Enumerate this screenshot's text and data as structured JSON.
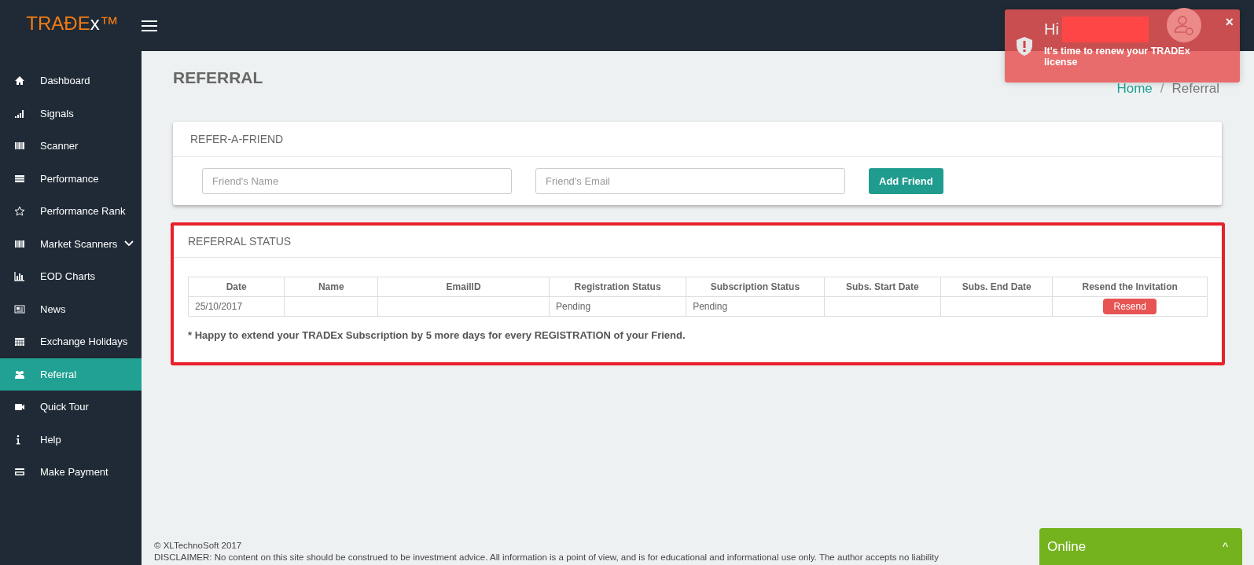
{
  "header": {
    "logo_main": "TRAĐE",
    "logo_x": "x",
    "logo_tm": "™"
  },
  "sidebar": {
    "items": [
      {
        "label": "Dashboard",
        "selected": false,
        "submenu": false
      },
      {
        "label": "Signals",
        "selected": false,
        "submenu": false
      },
      {
        "label": "Scanner",
        "selected": false,
        "submenu": false
      },
      {
        "label": "Performance",
        "selected": false,
        "submenu": false
      },
      {
        "label": "Performance Rank",
        "selected": false,
        "submenu": false
      },
      {
        "label": "Market Scanners",
        "selected": false,
        "submenu": true
      },
      {
        "label": "EOD Charts",
        "selected": false,
        "submenu": false
      },
      {
        "label": "News",
        "selected": false,
        "submenu": false
      },
      {
        "label": "Exchange Holidays",
        "selected": false,
        "submenu": false
      },
      {
        "label": "Referral",
        "selected": true,
        "submenu": false
      },
      {
        "label": "Quick Tour",
        "selected": false,
        "submenu": false
      },
      {
        "label": "Help",
        "selected": false,
        "submenu": false
      },
      {
        "label": "Make Payment",
        "selected": false,
        "submenu": false
      }
    ]
  },
  "page_title": "REFERRAL",
  "breadcrumb": [
    {
      "label": "Home",
      "kind": "link"
    },
    {
      "label": "/",
      "kind": "separator"
    },
    {
      "label": "Referral",
      "kind": "current"
    }
  ],
  "refer_card": {
    "title": "REFER-A-FRIEND",
    "name_field": {
      "placeholder": "Friend's Name"
    },
    "email_field": {
      "placeholder": "Friend's Email"
    },
    "button": "Add Friend"
  },
  "status_card": {
    "title": "REFERRAL STATUS",
    "highlighted": true,
    "table": {
      "columns": [
        "Date",
        "Name",
        "EmailID",
        "Registration Status",
        "Subscription Status",
        "Subs. Start Date",
        "Subs. End Date",
        "Resend the Invitation"
      ],
      "rows": [
        {
          "cells": [
            "25/10/2017",
            "",
            "",
            "Pending",
            "Pending",
            "",
            ""
          ],
          "action": "Resend"
        }
      ]
    },
    "note": "* Happy to extend your TRADEx Subscription by 5 more days for every REGISTRATION of your Friend."
  },
  "notification": {
    "greeting": "Hi",
    "message": "It's time to renew your TRADEx license",
    "close": "×"
  },
  "footer": {
    "copyright": "© XLTechnoSoft 2017",
    "disclaimer": "DISCLAIMER: No content on this site should be construed to be investment advice. All information is a point of view, and is for educational and informational use only. The author accepts no liability"
  },
  "chat": {
    "label": "Online",
    "caret": "^"
  }
}
